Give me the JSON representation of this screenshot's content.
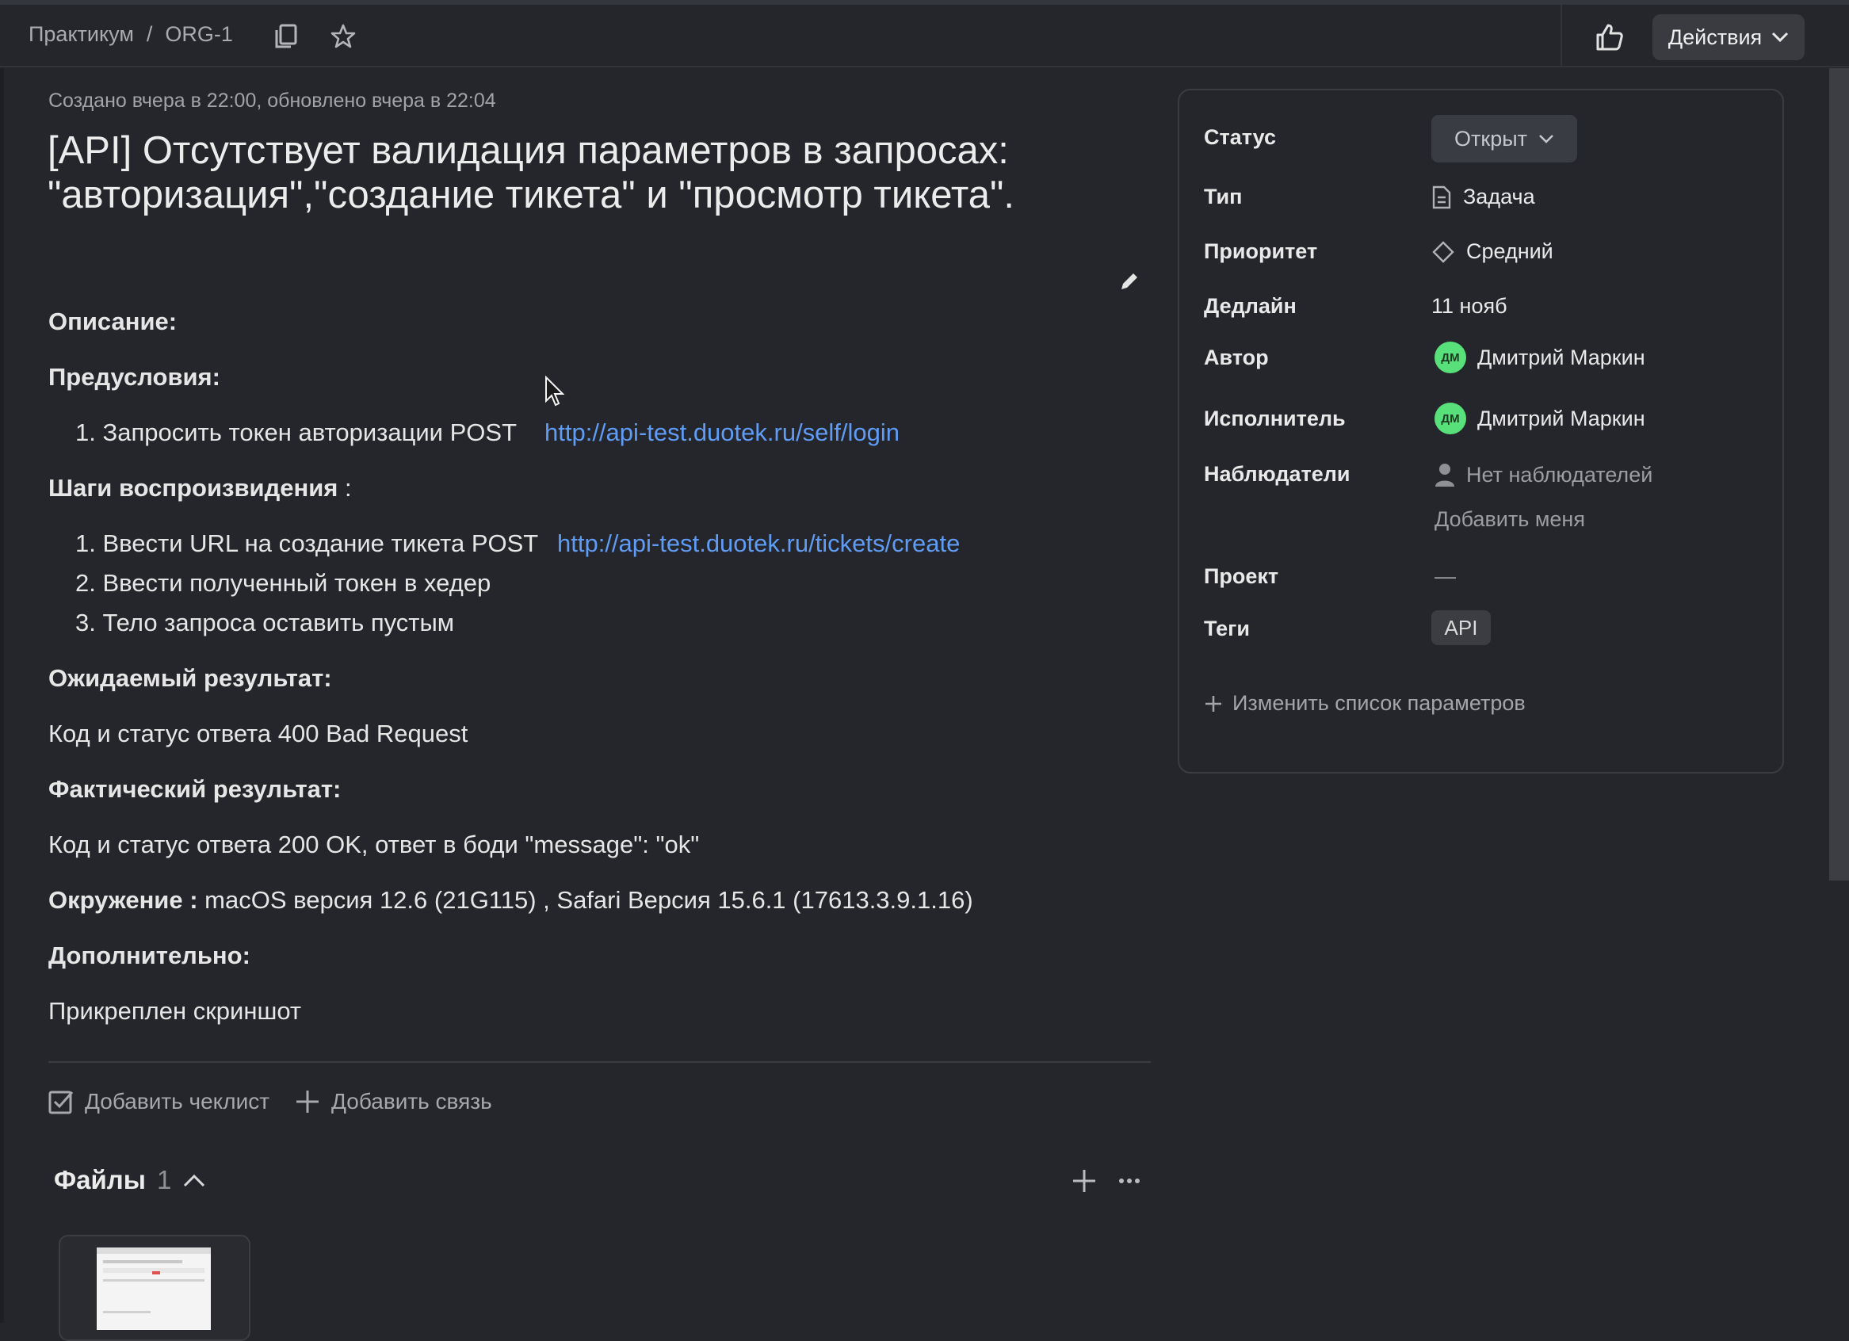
{
  "breadcrumb": {
    "root": "Практикум",
    "separator": "/",
    "issue_key": "ORG-1"
  },
  "header": {
    "actions_label": "Действия",
    "icons": [
      "copy-icon",
      "star-icon",
      "thumbs-up-icon",
      "chevron-down-icon"
    ]
  },
  "issue": {
    "meta": "Создано вчера в 22:00, обновлено вчера в 22:04",
    "title": "[API] Отсутствует валидация параметров в запросах: \"авторизация\",\"создание тикета\" и \"просмотр тикета\"."
  },
  "description": {
    "heading": "Описание:",
    "preconditions_heading": "Предусловия:",
    "preconditions": [
      {
        "num": "1.",
        "text": "Запросить токен авторизации POST",
        "link": "http://api-test.duotek.ru/self/login"
      }
    ],
    "steps_heading": "Шаги воспроизвидения",
    "steps_colon": " :",
    "steps": [
      {
        "num": "1.",
        "text": "Ввести URL на создание тикета POST",
        "link": "http://api-test.duotek.ru/tickets/create"
      },
      {
        "num": "2.",
        "text": "Ввести полученный токен в хедер"
      },
      {
        "num": "3.",
        "text": "Тело запроса оставить пустым"
      }
    ],
    "expected_heading": "Ожидаемый результат:",
    "expected": "Код и статус ответа 400 Bad Request",
    "actual_heading": "Фактический результат:",
    "actual": "Код и статус ответа 200 OK, ответ в боди \"message\": \"ok\"",
    "env_heading": "Окружение :",
    "env_value": " macOS версия 12.6 (21G115) , Safari Версия 15.6.1 (17613.3.9.1.16)",
    "additional_heading": "Дополнительно:",
    "additional": "Прикреплен скриншот"
  },
  "footer": {
    "add_checklist": "Добавить чеклист",
    "add_link": "Добавить связь"
  },
  "files": {
    "title": "Файлы",
    "count": "1"
  },
  "sidebar": {
    "status_label": "Статус",
    "status_value": "Открыт",
    "type_label": "Тип",
    "type_value": "Задача",
    "priority_label": "Приоритет",
    "priority_value": "Средний",
    "deadline_label": "Дедлайн",
    "deadline_value": "11 нояб",
    "author_label": "Автор",
    "author_initials": "ДМ",
    "author_name": "Дмитрий Маркин",
    "assignee_label": "Исполнитель",
    "assignee_initials": "ДМ",
    "assignee_name": "Дмитрий Маркин",
    "watchers_label": "Наблюдатели",
    "watchers_value": "Нет наблюдателей",
    "add_me": "Добавить меня",
    "project_label": "Проект",
    "project_value": "—",
    "tags_label": "Теги",
    "tag": "API",
    "edit_params": "Изменить список параметров"
  },
  "colors": {
    "background": "#25262b",
    "link": "#5f9cf5",
    "avatar": "#58e07a"
  }
}
